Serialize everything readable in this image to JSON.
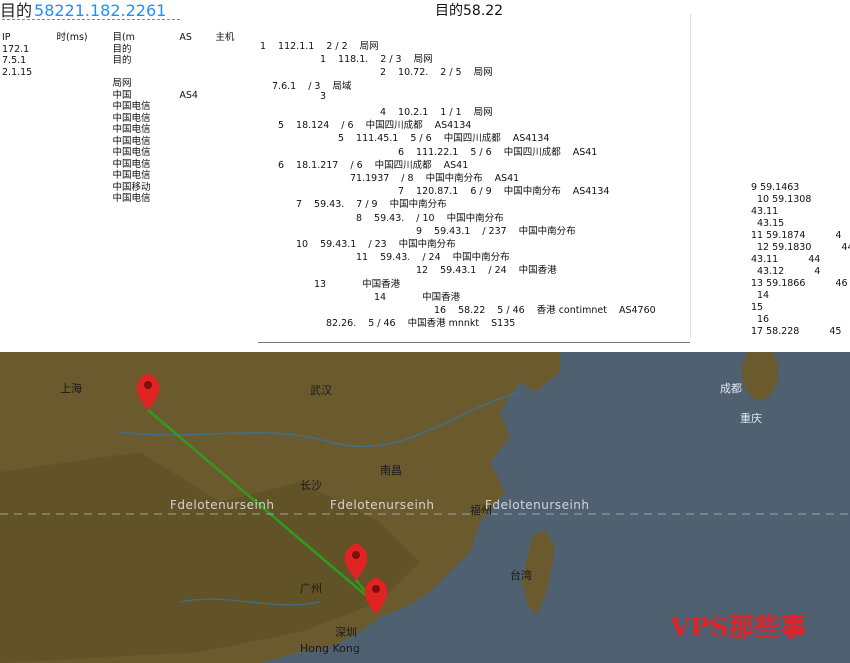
{
  "header": {
    "title_label": "目的",
    "title_ip": "58221.182.2261",
    "window_label": "目的58.22"
  },
  "table": {
    "columns": [
      "IP",
      "时(ms)",
      "目(m",
      "AS",
      "主机"
    ],
    "rows": [
      [
        "172.1",
        "",
        "目的",
        "",
        ""
      ],
      [
        "7.5.1",
        "",
        "目的",
        "",
        ""
      ],
      [
        "2.1.15",
        "",
        "",
        "",
        ""
      ],
      [
        "",
        "",
        "局网",
        "",
        ""
      ],
      [
        "",
        "",
        "中国",
        "AS4",
        ""
      ],
      [
        "",
        "",
        "中国电信",
        "",
        ""
      ],
      [
        "",
        "",
        "中国电信",
        "",
        ""
      ],
      [
        "",
        "",
        "中国电信",
        "",
        ""
      ],
      [
        "",
        "",
        "中国电信",
        "",
        ""
      ],
      [
        "",
        "",
        "中国电信",
        "",
        ""
      ],
      [
        "",
        "",
        "中国电信",
        "",
        ""
      ],
      [
        "",
        "",
        "中国电信",
        "",
        ""
      ],
      [
        "",
        "",
        "中国移动",
        "",
        ""
      ],
      [
        "",
        "",
        "中国电信",
        "",
        ""
      ]
    ]
  },
  "hops": [
    {
      "n": "1",
      "ip": "112.1.1",
      "time": "2 / 2",
      "loc": "局网",
      "as": ""
    },
    {
      "n": "1",
      "ip": "118.1.",
      "time": "2 / 3",
      "loc": "局网",
      "as": ""
    },
    {
      "n": "2",
      "ip": "10.72.",
      "time": "2 / 5",
      "loc": "局网",
      "as": ""
    },
    {
      "n": "",
      "ip": "7.6.1",
      "time": "/ 3",
      "loc": "局域",
      "as": ""
    },
    {
      "n": "3",
      "ip": "",
      "time": "",
      "loc": "",
      "as": ""
    },
    {
      "n": "4",
      "ip": "10.2.1",
      "time": "1 / 1",
      "loc": "局网",
      "as": ""
    },
    {
      "n": "5",
      "ip": "18.124",
      "time": "/ 6",
      "loc": "中国四川成都",
      "as": "AS4134"
    },
    {
      "n": "5",
      "ip": "111.45.1",
      "time": "5 / 6",
      "loc": "中国四川成都",
      "as": "AS4134"
    },
    {
      "n": "6",
      "ip": "111.22.1",
      "time": "5 / 6",
      "loc": "中国四川成都",
      "as": "AS41"
    },
    {
      "n": "6",
      "ip": "18.1.217",
      "time": "/ 6",
      "loc": "中国四川成都",
      "as": "AS41"
    },
    {
      "n": "",
      "ip": "71.1937",
      "time": "/ 8",
      "loc": "中国中南分布",
      "as": "AS41"
    },
    {
      "n": "7",
      "ip": "120.87.1",
      "time": "6 / 9",
      "loc": "中国中南分布",
      "as": "AS4134"
    },
    {
      "n": "7",
      "ip": "59.43.",
      "time": "7 / 9",
      "loc": "中国中南分布",
      "as": ""
    },
    {
      "n": "8",
      "ip": "59.43.",
      "time": "/ 10",
      "loc": "中国中南分布",
      "as": ""
    },
    {
      "n": "9",
      "ip": "59.43.1",
      "time": "/ 237",
      "loc": "中国中南分布",
      "as": ""
    },
    {
      "n": "10",
      "ip": "59.43.1",
      "time": "/ 23",
      "loc": "中国中南分布",
      "as": ""
    },
    {
      "n": "11",
      "ip": "59.43.",
      "time": "/ 24",
      "loc": "中国中南分布",
      "as": ""
    },
    {
      "n": "12",
      "ip": "59.43.1",
      "time": "/ 24",
      "loc": "中国香港",
      "as": ""
    },
    {
      "n": "13",
      "ip": "",
      "time": "",
      "loc": "中国香港",
      "as": ""
    },
    {
      "n": "14",
      "ip": "",
      "time": "",
      "loc": "中国香港",
      "as": ""
    },
    {
      "n": "16",
      "ip": "58.22",
      "time": "5 / 46",
      "loc": "香港 contimnet",
      "as": "AS4760"
    },
    {
      "n": "",
      "ip": "82.26.",
      "time": "5 / 46",
      "loc": "中国香港 mnnkt",
      "as": "S135"
    }
  ],
  "right_panel": {
    "rows": [
      {
        "label": "9 59.1463",
        "value": ""
      },
      {
        "label": "10 59.1308",
        "value": ""
      },
      {
        "label": "43.11",
        "value": ""
      },
      {
        "label": "43.15",
        "value": ""
      },
      {
        "label": "11 59.1874",
        "value": "4"
      },
      {
        "label": "12 59.1830",
        "value": "44"
      },
      {
        "label": "43.11",
        "value": "44"
      },
      {
        "label": "43.12",
        "value": "4"
      },
      {
        "label": "13 59.1866",
        "value": "46"
      },
      {
        "label": "14",
        "value": ""
      },
      {
        "label": "15",
        "value": ""
      },
      {
        "label": "16",
        "value": ""
      },
      {
        "label": "17 58.228",
        "value": "45"
      }
    ]
  },
  "map": {
    "cities": [
      {
        "name": "上海",
        "tone": "dark"
      },
      {
        "name": "成都",
        "tone": "light"
      },
      {
        "name": "重庆",
        "tone": "light"
      },
      {
        "name": "武汉",
        "tone": "dark"
      },
      {
        "name": "长沙",
        "tone": "dark"
      },
      {
        "name": "南昌",
        "tone": "dark"
      },
      {
        "name": "福州",
        "tone": "dark"
      },
      {
        "name": "广州",
        "tone": "dark"
      },
      {
        "name": "深圳",
        "tone": "dark"
      },
      {
        "name": "Hong Kong",
        "tone": "dark"
      },
      {
        "name": "台湾",
        "tone": "dark"
      }
    ],
    "watermark_text": "Fdelotenurseinh",
    "brand_text": "VPS那些事",
    "route_color": "#2f9b1e",
    "marker_color": "#e02323"
  }
}
